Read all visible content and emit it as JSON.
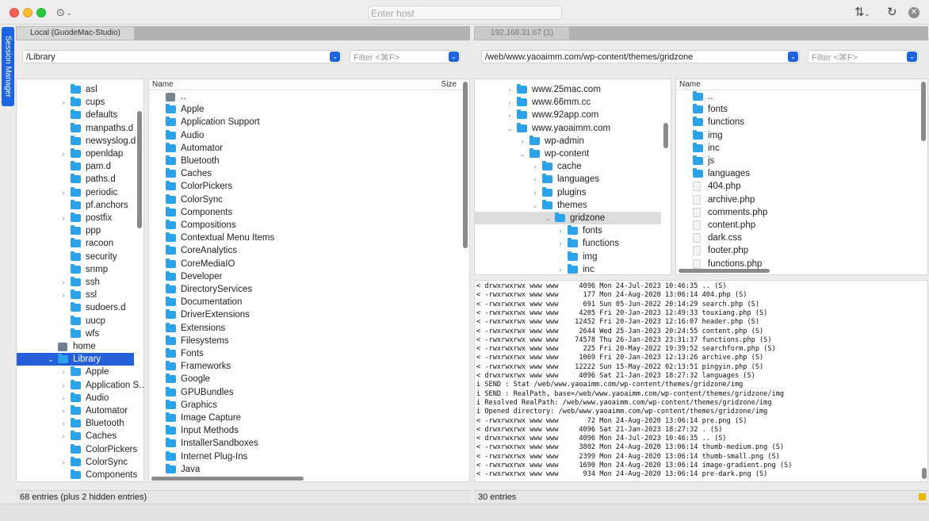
{
  "titlebar": {
    "host_placeholder": "Enter host",
    "more_icon": "ellipsis-circle-icon",
    "transfer_icon": "sort-arrows-icon",
    "refresh_icon": "refresh-icon",
    "close_icon": "close-circle-icon"
  },
  "session_manager": "Session Manager",
  "local": {
    "tab": "Local (GuodeMac-Studio)",
    "path": "/Library",
    "filter_placeholder": "Filter <⌘F>",
    "status": "68 entries (plus 2 hidden entries)",
    "header_name": "Name",
    "header_size": "Size",
    "tree": [
      {
        "label": "asl",
        "indent": 2,
        "arrow": ""
      },
      {
        "label": "cups",
        "indent": 2,
        "arrow": "›"
      },
      {
        "label": "defaults",
        "indent": 2,
        "arrow": ""
      },
      {
        "label": "manpaths.d",
        "indent": 2,
        "arrow": ""
      },
      {
        "label": "newsyslog.d",
        "indent": 2,
        "arrow": ""
      },
      {
        "label": "openldap",
        "indent": 2,
        "arrow": "›"
      },
      {
        "label": "pam.d",
        "indent": 2,
        "arrow": ""
      },
      {
        "label": "paths.d",
        "indent": 2,
        "arrow": ""
      },
      {
        "label": "periodic",
        "indent": 2,
        "arrow": "›"
      },
      {
        "label": "pf.anchors",
        "indent": 2,
        "arrow": ""
      },
      {
        "label": "postfix",
        "indent": 2,
        "arrow": "›"
      },
      {
        "label": "ppp",
        "indent": 2,
        "arrow": ""
      },
      {
        "label": "racoon",
        "indent": 2,
        "arrow": ""
      },
      {
        "label": "security",
        "indent": 2,
        "arrow": ""
      },
      {
        "label": "snmp",
        "indent": 2,
        "arrow": ""
      },
      {
        "label": "ssh",
        "indent": 2,
        "arrow": "›"
      },
      {
        "label": "ssl",
        "indent": 2,
        "arrow": "›"
      },
      {
        "label": "sudoers.d",
        "indent": 2,
        "arrow": ""
      },
      {
        "label": "uucp",
        "indent": 2,
        "arrow": ""
      },
      {
        "label": "wfs",
        "indent": 2,
        "arrow": ""
      },
      {
        "label": "home",
        "indent": 1,
        "arrow": "",
        "icon": "disk"
      },
      {
        "label": "Library",
        "indent": 1,
        "arrow": "⌄",
        "selected": true
      },
      {
        "label": "Apple",
        "indent": 2,
        "arrow": "›"
      },
      {
        "label": "Application S...",
        "indent": 2,
        "arrow": "›"
      },
      {
        "label": "Audio",
        "indent": 2,
        "arrow": "›"
      },
      {
        "label": "Automator",
        "indent": 2,
        "arrow": "›"
      },
      {
        "label": "Bluetooth",
        "indent": 2,
        "arrow": "›"
      },
      {
        "label": "Caches",
        "indent": 2,
        "arrow": "›"
      },
      {
        "label": "ColorPickers",
        "indent": 2,
        "arrow": ""
      },
      {
        "label": "ColorSync",
        "indent": 2,
        "arrow": "›"
      },
      {
        "label": "Components",
        "indent": 2,
        "arrow": ""
      }
    ],
    "files": [
      {
        "label": "..",
        "icon": "up"
      },
      {
        "label": "Apple"
      },
      {
        "label": "Application Support"
      },
      {
        "label": "Audio"
      },
      {
        "label": "Automator"
      },
      {
        "label": "Bluetooth"
      },
      {
        "label": "Caches"
      },
      {
        "label": "ColorPickers"
      },
      {
        "label": "ColorSync"
      },
      {
        "label": "Components"
      },
      {
        "label": "Compositions"
      },
      {
        "label": "Contextual Menu Items"
      },
      {
        "label": "CoreAnalytics"
      },
      {
        "label": "CoreMediaIO"
      },
      {
        "label": "Developer"
      },
      {
        "label": "DirectoryServices"
      },
      {
        "label": "Documentation"
      },
      {
        "label": "DriverExtensions"
      },
      {
        "label": "Extensions"
      },
      {
        "label": "Filesystems"
      },
      {
        "label": "Fonts"
      },
      {
        "label": "Frameworks"
      },
      {
        "label": "Google"
      },
      {
        "label": "GPUBundles"
      },
      {
        "label": "Graphics"
      },
      {
        "label": "Image Capture"
      },
      {
        "label": "Input Methods"
      },
      {
        "label": "InstallerSandboxes"
      },
      {
        "label": "Internet Plug-Ins"
      },
      {
        "label": "Java"
      }
    ]
  },
  "remote": {
    "tab": "192.168.31.67 (1)",
    "path": "/web/www.yaoaimm.com/wp-content/themes/gridzone",
    "filter_placeholder": "Filter <⌘F>",
    "status": "30 entries",
    "header_name": "Name",
    "tree": [
      {
        "label": "www.25mac.com",
        "indent": 0,
        "arrow": "›"
      },
      {
        "label": "www.66mm.cc",
        "indent": 0,
        "arrow": "›"
      },
      {
        "label": "www.92app.com",
        "indent": 0,
        "arrow": "›"
      },
      {
        "label": "www.yaoaimm.com",
        "indent": 0,
        "arrow": "⌄"
      },
      {
        "label": "wp-admin",
        "indent": 1,
        "arrow": "›"
      },
      {
        "label": "wp-content",
        "indent": 1,
        "arrow": "⌄"
      },
      {
        "label": "cache",
        "indent": 2,
        "arrow": "›"
      },
      {
        "label": "languages",
        "indent": 2,
        "arrow": "›"
      },
      {
        "label": "plugins",
        "indent": 2,
        "arrow": "›"
      },
      {
        "label": "themes",
        "indent": 2,
        "arrow": "⌄"
      },
      {
        "label": "gridzone",
        "indent": 3,
        "arrow": "⌄",
        "graysel": true
      },
      {
        "label": "fonts",
        "indent": 4,
        "arrow": "›"
      },
      {
        "label": "functions",
        "indent": 4,
        "arrow": "›"
      },
      {
        "label": "img",
        "indent": 4,
        "arrow": ""
      },
      {
        "label": "inc",
        "indent": 4,
        "arrow": "›"
      }
    ],
    "files": [
      {
        "label": "..",
        "icon": "folder"
      },
      {
        "label": "fonts",
        "icon": "folder"
      },
      {
        "label": "functions",
        "icon": "folder"
      },
      {
        "label": "img",
        "icon": "folder"
      },
      {
        "label": "inc",
        "icon": "folder"
      },
      {
        "label": "js",
        "icon": "folder"
      },
      {
        "label": "languages",
        "icon": "folder"
      },
      {
        "label": "404.php",
        "icon": "file"
      },
      {
        "label": "archive.php",
        "icon": "file"
      },
      {
        "label": "comments.php",
        "icon": "file"
      },
      {
        "label": "content.php",
        "icon": "file"
      },
      {
        "label": "dark.css",
        "icon": "file"
      },
      {
        "label": "footer.php",
        "icon": "file"
      },
      {
        "label": "functions.php",
        "icon": "file"
      }
    ]
  },
  "log": [
    "< drwxrwxrwx www www     4096 Mon 24-Jul-2023 10:46:35 .. (S)",
    "< -rwxrwxrwx www www      177 Mon 24-Aug-2020 13:06:14 404.php (S)",
    "< -rwxrwxrwx www www      691 Sun 05-Jun-2022 20:14:29 search.php (S)",
    "< -rwxrwxrwx www www     4205 Fri 20-Jan-2023 12:49:33 touxiang.php (S)",
    "< -rwxrwxrwx www www    12452 Fri 20-Jan-2023 12:16:07 header.php (S)",
    "< -rwxrwxrwx www www     2644 Wed 25-Jan-2023 20:24:55 content.php (S)",
    "< -rwxrwxrwx www www    74578 Thu 26-Jan-2023 23:31:37 functions.php (S)",
    "< -rwxrwxrwx www www      225 Fri 20-May-2022 19:39:52 searchform.php (S)",
    "< -rwxrwxrwx www www     1069 Fri 20-Jan-2023 12:13:26 archive.php (S)",
    "< -rwxrwxrwx www www    12222 Sun 15-May-2022 02:13:51 pingyin.php (S)",
    "< drwxrwxrwx www www     4096 Sat 21-Jan-2023 18:27:32 languages (S)",
    "i SEND : Stat /web/www.yaoaimm.com/wp-content/themes/gridzone/img",
    "i SEND : RealPath, base=/web/www.yaoaimm.com/wp-content/themes/gridzone/img",
    "i Resolved RealPath: /web/www.yaoaimm.com/wp-content/themes/gridzone/img",
    "i Opened directory: /web/www.yaoaimm.com/wp-content/themes/gridzone/img",
    "< -rwxrwxrwx www www       72 Mon 24-Aug-2020 13:06:14 pre.png (S)",
    "< drwxrwxrwx www www     4096 Sat 21-Jan-2023 18:27:32 . (S)",
    "< drwxrwxrwx www www     4096 Mon 24-Jul-2023 10:46:35 .. (S)",
    "< -rwxrwxrwx www www     3802 Mon 24-Aug-2020 13:06:14 thumb-medium.png (S)",
    "< -rwxrwxrwx www www     2399 Mon 24-Aug-2020 13:06:14 thumb-small.png (S)",
    "< -rwxrwxrwx www www     1690 Mon 24-Aug-2020 13:06:14 image-gradient.png (S)",
    "< -rwxrwxrwx www www      934 Mon 24-Aug-2020 13:06:14 pre-dark.png (S)"
  ]
}
